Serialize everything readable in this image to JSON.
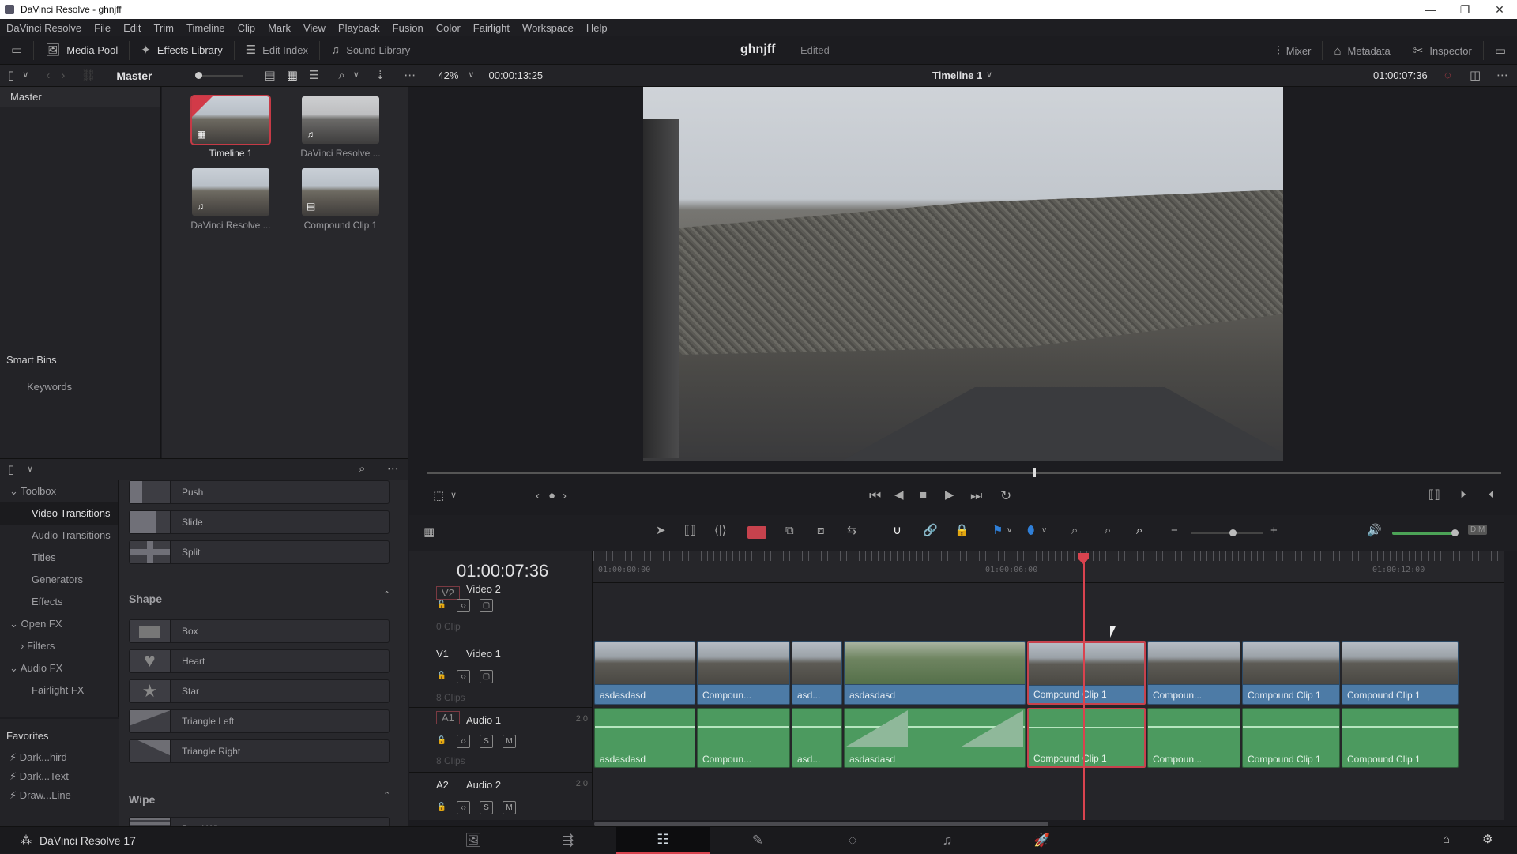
{
  "window": {
    "title": "DaVinci Resolve - ghnjff",
    "minimize": "—",
    "restore": "❐",
    "close": "✕"
  },
  "menu": [
    "DaVinci Resolve",
    "File",
    "Edit",
    "Trim",
    "Timeline",
    "Clip",
    "Mark",
    "View",
    "Playback",
    "Fusion",
    "Color",
    "Fairlight",
    "Workspace",
    "Help"
  ],
  "toolbar": {
    "media_pool": "Media Pool",
    "effects_library": "Effects Library",
    "edit_index": "Edit Index",
    "sound_library": "Sound Library",
    "project_name": "ghnjff",
    "project_state": "Edited",
    "mixer": "Mixer",
    "metadata": "Metadata",
    "inspector": "Inspector"
  },
  "pool_bar": {
    "bin": "Master",
    "zoom": "42%",
    "source_timecode": "00:00:13:25",
    "timeline_name": "Timeline 1",
    "record_timecode": "01:00:07:36"
  },
  "bins": {
    "master": "Master",
    "smart_bins": "Smart Bins",
    "keywords": "Keywords"
  },
  "media_items": [
    {
      "name": "Timeline 1",
      "type": "timeline",
      "selected": true
    },
    {
      "name": "DaVinci Resolve ...",
      "type": "audio-video",
      "selected": false
    },
    {
      "name": "DaVinci Resolve ...",
      "type": "audio-video",
      "selected": false
    },
    {
      "name": "Compound Clip 1",
      "type": "compound",
      "selected": false
    }
  ],
  "fx_tree": {
    "toolbox": "Toolbox",
    "video_transitions": "Video Transitions",
    "audio_transitions": "Audio Transitions",
    "titles": "Titles",
    "generators": "Generators",
    "effects": "Effects",
    "open_fx": "Open FX",
    "filters": "Filters",
    "audio_fx": "Audio FX",
    "fairlight_fx": "Fairlight FX"
  },
  "favorites": {
    "title": "Favorites",
    "items": [
      "Dark...hird",
      "Dark...Text",
      "Draw...Line"
    ]
  },
  "fx_list": {
    "slide_group": [
      "Push",
      "Slide",
      "Split"
    ],
    "shape_title": "Shape",
    "shape_items": [
      "Box",
      "Heart",
      "Star",
      "Triangle Left",
      "Triangle Right"
    ],
    "wipe_title": "Wipe",
    "wipe_items": [
      "Band Wipe"
    ]
  },
  "timeline": {
    "timecode": "01:00:07:36",
    "ruler": [
      "01:00:00:00",
      "01:00:06:00",
      "01:00:12:00"
    ],
    "tracks": {
      "v2": {
        "tag": "V2",
        "name": "Video 2",
        "count": "0 Clip"
      },
      "v1": {
        "tag": "V1",
        "name": "Video 1",
        "count": "8 Clips"
      },
      "a1": {
        "tag": "A1",
        "name": "Audio 1",
        "channels": "2.0",
        "count": "8 Clips"
      },
      "a2": {
        "tag": "A2",
        "name": "Audio 2",
        "channels": "2.0"
      }
    },
    "clips": [
      "asdasdasd",
      "Compoun...",
      "asd...",
      "asdasdasd",
      "Compound Clip 1",
      "Compoun...",
      "Compound Clip 1",
      "Compound Clip 1"
    ],
    "selected_clip_index": 4,
    "solo": "S",
    "mute": "M",
    "dim": "DIM"
  },
  "footer": {
    "brand": "DaVinci Resolve 17",
    "active_page": "edit"
  },
  "colors": {
    "accent_red": "#d9434f",
    "video_clip": "#4d7ba6",
    "audio_clip": "#4c9a5f"
  }
}
